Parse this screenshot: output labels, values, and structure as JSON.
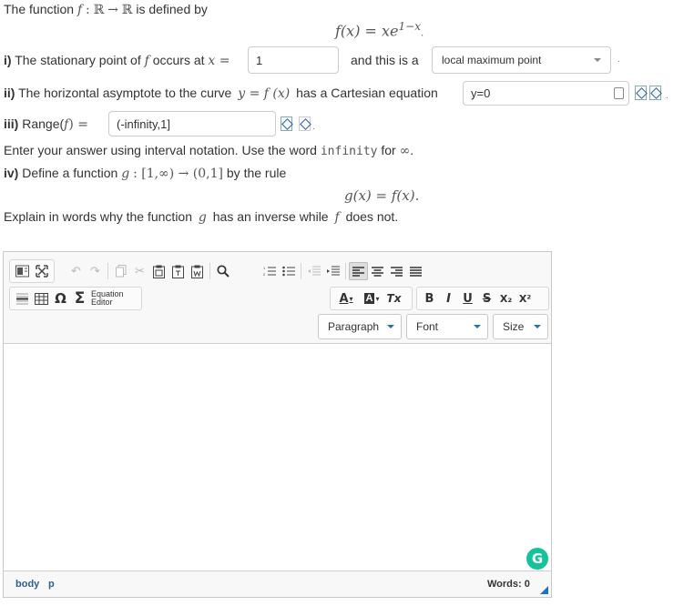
{
  "intro": {
    "text": "The function",
    "f": "f",
    "colon": ":",
    "domain": "ℝ",
    "arrow": "→",
    "codomain": "ℝ",
    "tail": "is defined by"
  },
  "definition": {
    "lhs": "f(x) =",
    "x": "x",
    "e": "e",
    "exponent": "1−x",
    "dot": "."
  },
  "part_i": {
    "label": "i)",
    "text": "The stationary point of",
    "f": "f",
    "occurs": "occurs at",
    "var": "x =",
    "value": "1",
    "mid": "and this is a",
    "select_value": "local maximum point",
    "dot": "."
  },
  "part_ii": {
    "label": "ii)",
    "text1": "The horizontal asymptote to the curve",
    "curve": "y = f (x)",
    "text2": "has a Cartesian equation",
    "value": "y=0",
    "dot": "."
  },
  "part_iii": {
    "label": "iii)",
    "range_label": "Range(",
    "f": "f",
    "range_close": ") =",
    "value": "(-infinity,1]",
    "dot": "."
  },
  "interval_note": {
    "text1": "Enter your answer using interval notation. Use the word",
    "code": "infinity",
    "text2": "for",
    "symbol": "∞",
    "dot": "."
  },
  "part_iv": {
    "label": "iv)",
    "text1": "Define a function",
    "g": "g",
    "mapping": ": [1,∞) → (0,1]",
    "text2": "by the rule",
    "rule": "g(x) = f(x)."
  },
  "explain": {
    "text1": "Explain in words why the function",
    "g": "g",
    "text2": "has an inverse while",
    "f": "f",
    "text3": "does not."
  },
  "editor": {
    "equation_editor_line1": "Equation",
    "equation_editor_line2": "Editor",
    "paragraph": "Paragraph",
    "font": "Font",
    "size": "Size",
    "bold": "B",
    "italic": "I",
    "underline": "U",
    "strike": "S",
    "subscript": "X₂",
    "superscript": "X²",
    "omega": "Ω",
    "sigma": "Σ",
    "text_color": "A",
    "bg_color": "A",
    "remove_format": "Tx",
    "grammarly": "G",
    "path_body": "body",
    "path_p": "p",
    "words_label": "Words: 0"
  },
  "colors": {
    "accent": "#1e73be",
    "grammarly": "#15c39a",
    "statusbar_text": "#2f5f8e"
  }
}
